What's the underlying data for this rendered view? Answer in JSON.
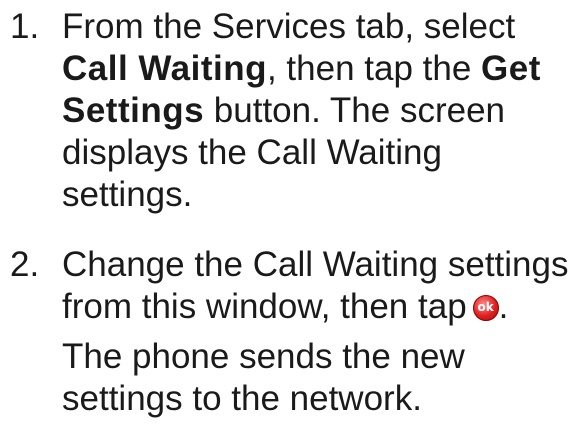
{
  "steps": [
    {
      "number": "1.",
      "text_1": "From the Services tab, select",
      "bold_1": "Call Waiting",
      "text_2": ", then tap the ",
      "bold_2": "Get",
      "bold_3": "Settings",
      "text_3": " button. The screen",
      "line_4": "displays the Call Waiting",
      "line_5": "settings."
    },
    {
      "number": "2.",
      "line_1": "Change the Call Waiting settings",
      "line_2_prefix": "from this window, then tap",
      "line_2_suffix": "."
    }
  ],
  "note": {
    "line_1": "The phone sends the new",
    "line_2": "settings to the network."
  },
  "icons": {
    "ok_button": "ok-icon",
    "ok_color": "#e02020"
  }
}
